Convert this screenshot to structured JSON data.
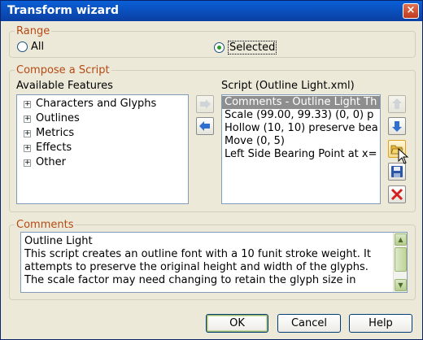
{
  "window": {
    "title": "Transform wizard",
    "close_glyph": "×"
  },
  "range": {
    "legend": "Range",
    "options": [
      {
        "label": "All",
        "selected": false
      },
      {
        "label": "Selected",
        "selected": true
      }
    ]
  },
  "compose": {
    "legend": "Compose a Script",
    "features_label": "Available Features",
    "features": [
      {
        "label": "Characters and Glyphs",
        "expander": "+"
      },
      {
        "label": "Outlines",
        "expander": "+"
      },
      {
        "label": "Metrics",
        "expander": "+"
      },
      {
        "label": "Effects",
        "expander": "+"
      },
      {
        "label": "Other",
        "expander": "+"
      }
    ],
    "script_label": "Script (Outline Light.xml)",
    "script_items": [
      "Comments - Outline Light Th",
      "Scale (99.00, 99.33) (0, 0) p",
      "Hollow (10, 10) preserve bea",
      "Move (0, 5)",
      "Left Side Bearing Point at x="
    ],
    "selected_script_index": 0,
    "icons": {
      "add": "arrow-right-icon",
      "remove": "arrow-left-icon",
      "move_up": "arrow-up-icon",
      "move_down": "arrow-down-icon",
      "open": "open-folder-icon",
      "save": "floppy-disk-icon",
      "delete": "red-x-icon"
    }
  },
  "comments": {
    "legend": "Comments",
    "lines": [
      "Outline Light",
      "This script creates an outline font with a 10 funit stroke weight. It",
      "attempts to preserve the original height and width of the glyphs.",
      "The scale factor may need changing to retain the glyph size in"
    ]
  },
  "buttons": {
    "ok": "OK",
    "cancel": "Cancel",
    "help": "Help"
  },
  "colors": {
    "legend": "#b54a14",
    "titlebar": "#0a5fd6",
    "selection": "#8e8e8e"
  }
}
